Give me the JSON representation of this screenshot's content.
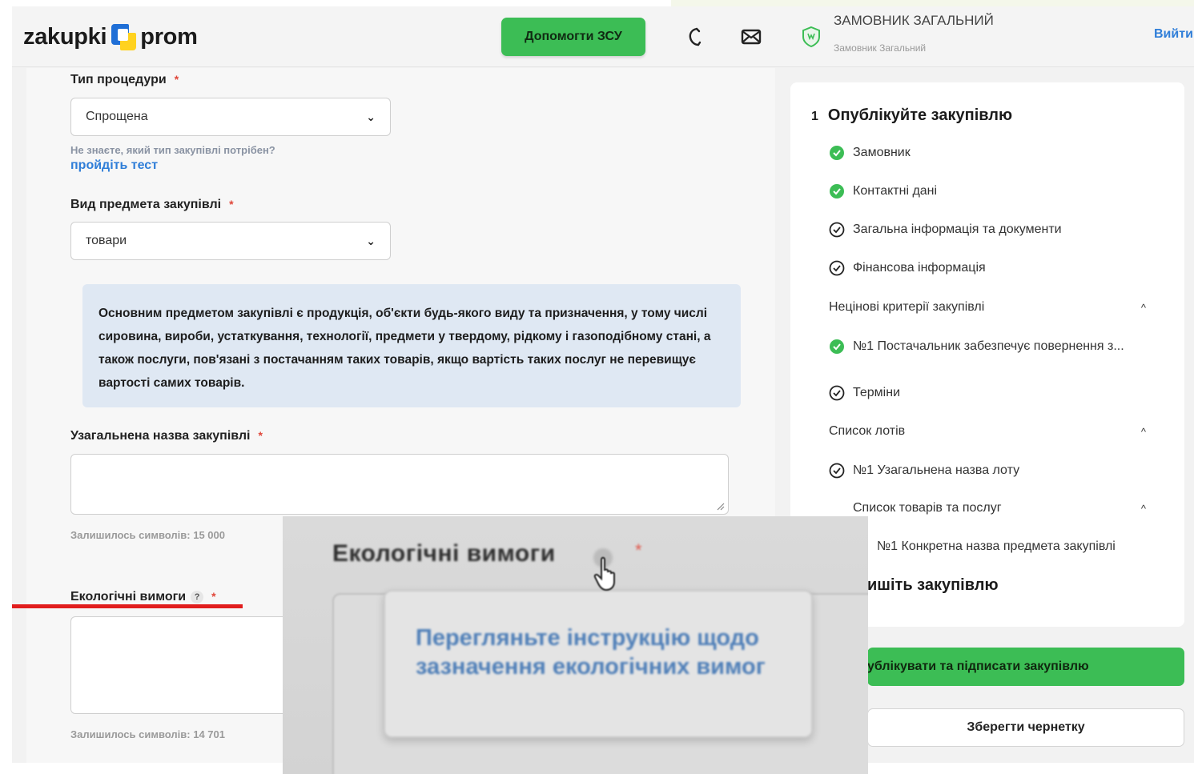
{
  "header": {
    "logo_left": "zakupki",
    "logo_right": "prom",
    "help_button": "Допомогти ЗСУ",
    "phone_icon": "phone-icon",
    "mail_icon": "mail-icon",
    "user_name": "ЗАМОВНИК ЗАГАЛЬНИЙ",
    "user_sub": "Замовник Загальний",
    "logout": "Вийти"
  },
  "form": {
    "procedure_type": {
      "label": "Тип процедури",
      "value": "Спрощена",
      "hint": "Не знаєте, який тип закупівлі потрібен?",
      "link": "пройдіть тест"
    },
    "subject_type": {
      "label": "Вид предмета закупівлі",
      "value": "товари"
    },
    "info_text": "Основним предметом закупівлі є продукція, об'єкти будь-якого виду та призначення, у тому числі сировина, вироби, устаткування, технології, предмети у твердому, рідкому і газоподібному стані, а також послуги, пов'язані з постачанням таких товарів, якщо вартість таких послуг не перевищує вартості самих товарів.",
    "general_name": {
      "label": "Узагальнена назва закупівлі",
      "value": "",
      "counter": "Залишилось символів: 15 000"
    },
    "eco": {
      "label": "Екологічні вимоги",
      "help": "?",
      "value": "",
      "counter": "Залишилось символів: 14 701"
    },
    "required_mark": "*"
  },
  "steps": {
    "number": "1",
    "title": "Опублікуйте закупівлю",
    "items": [
      {
        "label": "Замовник",
        "status": "done"
      },
      {
        "label": "Контактні дані",
        "status": "done"
      },
      {
        "label": "Загальна інформація та документи",
        "status": "pending"
      },
      {
        "label": "Фінансова інформація",
        "status": "pending"
      }
    ],
    "nonprice_section": "Нецінові критерії закупівлі",
    "nonprice_item": "№1 Постачальник забезпечує повернення з...",
    "terms": "Терміни",
    "lots_section": "Список лотів",
    "lot_item": "№1 Узагальнена назва лоту",
    "goods_section": "Список товарів та послуг",
    "goods_item": "№1 Конкретна назва предмета закупівлі",
    "sign_title": "ишіть закупівлю",
    "caret": "^"
  },
  "buttons": {
    "publish": "ублікувати та підписати закупівлю",
    "draft": "Зберегти чернетку"
  },
  "zoom": {
    "label": "Екологічні вимоги",
    "req": "*",
    "tooltip": "Перегляньте інструкцію щодо зазначення екологічних вимог"
  },
  "colors": {
    "accent_green": "#3cbd55",
    "link_blue": "#2f7ed8",
    "info_bg": "#dfe8f3",
    "required_red": "#e0473a",
    "highlight_red": "#e11d1d"
  }
}
